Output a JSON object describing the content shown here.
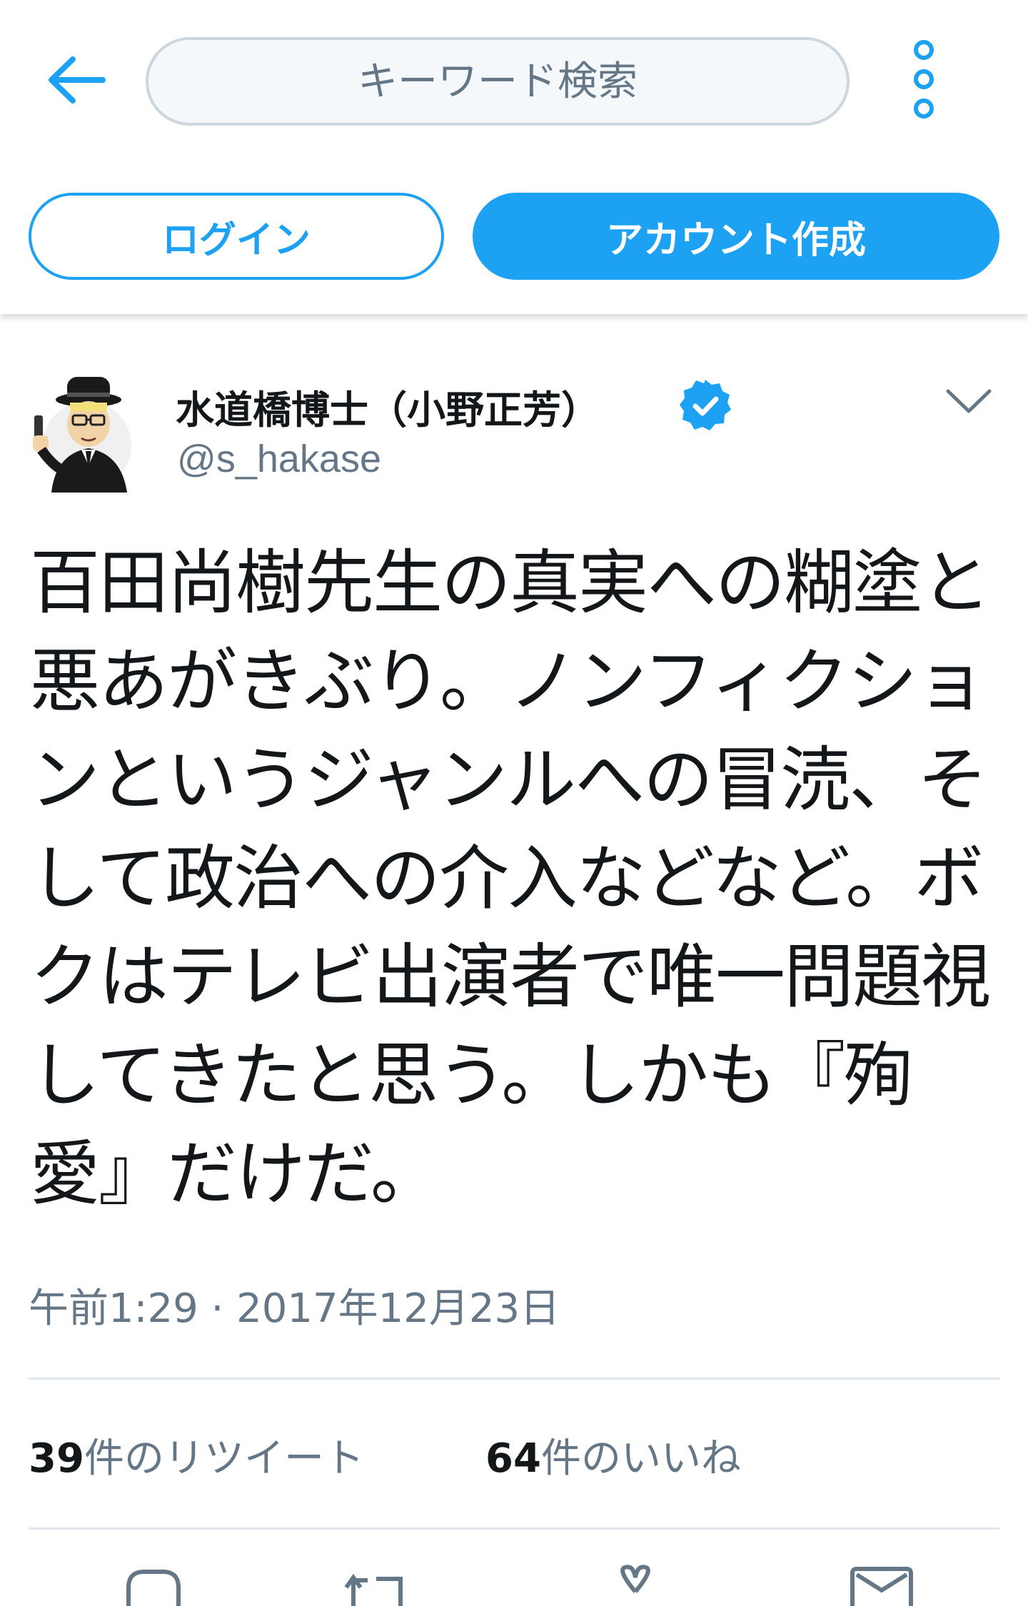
{
  "header": {
    "search_placeholder": "キーワード検索",
    "login_label": "ログイン",
    "signup_label": "アカウント作成"
  },
  "tweet": {
    "display_name": "水道橋博士（小野正芳）",
    "handle": "@s_hakase",
    "text": "百田尚樹先生の真実への糊塗と\n悪あがきぶり。ノンフィクショ\nンというジャンルへの冒涜、そ\nして政治への介入などなど。ボ\nクはテレビ出演者で唯一問題視\nしてきたと思う。しかも『殉\n愛』だけだ。",
    "timestamp": "午前1:29 · 2017年12月23日",
    "retweets": {
      "count": "39",
      "label": "件のリツイート"
    },
    "likes": {
      "count": "64",
      "label": "件のいいね"
    }
  },
  "icons": [
    "back-arrow-icon",
    "more-options-icon",
    "verified-badge-icon",
    "chevron-down-icon",
    "reply-icon",
    "retweet-icon",
    "like-icon",
    "share-icon"
  ],
  "colors": {
    "accent": "#1da1f2",
    "secondary_text": "#657786",
    "border": "#e1e8ed"
  }
}
